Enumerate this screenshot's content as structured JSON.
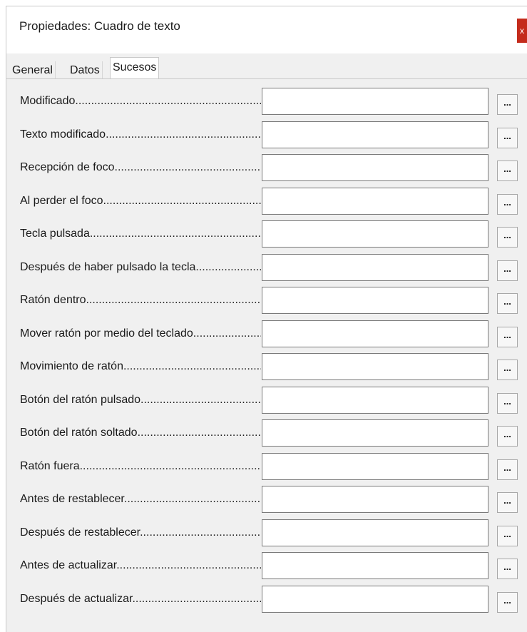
{
  "window": {
    "title": "Propiedades: Cuadro de texto",
    "close_label": "x"
  },
  "tabs": [
    {
      "label": "General",
      "active": false
    },
    {
      "label": "Datos",
      "active": false
    },
    {
      "label": "Sucesos",
      "active": true
    }
  ],
  "events": [
    {
      "label": "Modificado",
      "value": "",
      "button_label": "..."
    },
    {
      "label": "Texto modificado",
      "value": "",
      "button_label": "..."
    },
    {
      "label": "Recepción de foco",
      "value": "",
      "button_label": "..."
    },
    {
      "label": "Al perder el foco",
      "value": "",
      "button_label": "..."
    },
    {
      "label": "Tecla pulsada",
      "value": "",
      "button_label": "..."
    },
    {
      "label": "Después de haber pulsado la tecla",
      "value": "",
      "button_label": "..."
    },
    {
      "label": "Ratón dentro",
      "value": "",
      "button_label": "..."
    },
    {
      "label": "Mover ratón por medio del teclado",
      "value": "",
      "button_label": "..."
    },
    {
      "label": "Movimiento de ratón",
      "value": "",
      "button_label": "..."
    },
    {
      "label": "Botón del ratón pulsado",
      "value": "",
      "button_label": "..."
    },
    {
      "label": "Botón del ratón soltado",
      "value": "",
      "button_label": "..."
    },
    {
      "label": "Ratón fuera",
      "value": "",
      "button_label": "..."
    },
    {
      "label": "Antes de restablecer",
      "value": "",
      "button_label": "..."
    },
    {
      "label": "Después de restablecer",
      "value": "",
      "button_label": "..."
    },
    {
      "label": "Antes de actualizar",
      "value": "",
      "button_label": "..."
    },
    {
      "label": "Después de actualizar",
      "value": "",
      "button_label": "..."
    }
  ],
  "colors": {
    "close_button": "#c42b1c",
    "panel_background": "#f0f0f0"
  }
}
